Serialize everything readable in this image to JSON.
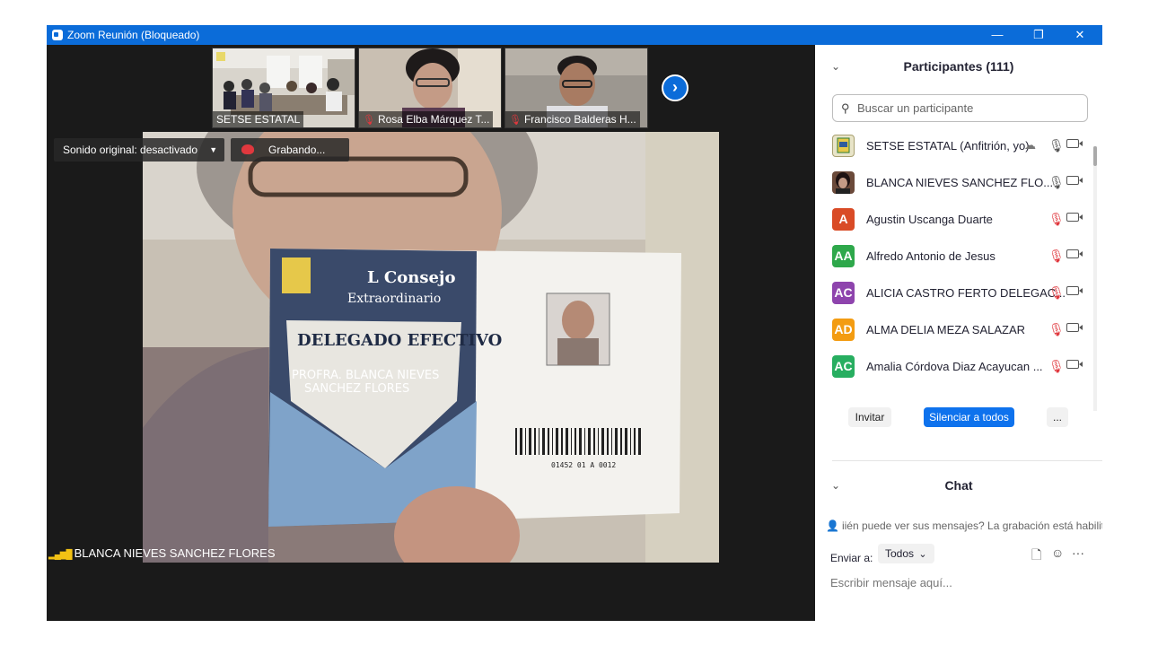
{
  "window": {
    "title": "Zoom Reunión (Bloqueado)",
    "minimize": "—",
    "restore": "❐",
    "close": "✕"
  },
  "strip": {
    "thumbnails": [
      {
        "name": "SETSE ESTATAL",
        "muted": false
      },
      {
        "name": "Rosa Elba Márquez T...",
        "muted": true
      },
      {
        "name": "Francisco Balderas H...",
        "muted": true
      }
    ],
    "next": "›"
  },
  "main_video": {
    "sound_label": "Sonido original: desactivado",
    "sound_arrow": "▼",
    "recording_label": "Grabando...",
    "speaker_name": "BLANCA NIEVES  SANCHEZ FLORES",
    "signal_icon": "signal-bars-icon",
    "card_text": {
      "line1": "L Consejo",
      "line2": "Extraordinario",
      "line3": "DELEGADO EFECTIVO",
      "line4": "PROFRA. BLANCA NIEVES",
      "line5": "SANCHEZ FLORES",
      "code": "01452 01 A 0012"
    }
  },
  "participants": {
    "header": "Participantes (111)",
    "chevron": "⌄",
    "search_placeholder": "Buscar un participante",
    "search_icon": "🔍",
    "list": [
      {
        "initials": "",
        "name": "SETSE ESTATAL (Anfitrión, yo)",
        "avatar_color": "#e8e4c8",
        "muted": false,
        "cloud": true
      },
      {
        "initials": "",
        "name": "BLANCA NIEVES  SANCHEZ FLO...",
        "avatar_color": "#6b4a3a",
        "muted": false,
        "cloud": false
      },
      {
        "initials": "A",
        "name": "Agustin Uscanga Duarte",
        "avatar_color": "#d94b26",
        "muted": true,
        "cloud": false
      },
      {
        "initials": "AA",
        "name": "Alfredo Antonio de Jesus",
        "avatar_color": "#2ea84b",
        "muted": true,
        "cloud": false
      },
      {
        "initials": "AC",
        "name": "ALICIA CASTRO FERTO DELEGAC...",
        "avatar_color": "#8e44ad",
        "muted": true,
        "cloud": false
      },
      {
        "initials": "AD",
        "name": "ALMA DELIA MEZA SALAZAR",
        "avatar_color": "#f39c12",
        "muted": true,
        "cloud": false
      },
      {
        "initials": "AC",
        "name": "Amalia Córdova Diaz Acayucan ...",
        "avatar_color": "#27ae60",
        "muted": true,
        "cloud": false
      }
    ],
    "mic_on": "🎙",
    "mic_off": "🎙",
    "buttons": {
      "invite": "Invitar",
      "mute_all": "Silenciar a todos",
      "more": "..."
    }
  },
  "chat": {
    "header": "Chat",
    "notice": "iién puede ver sus mensajes? La grabación está habilit",
    "send_to_label": "Enviar a:",
    "recipient": "Todos",
    "recipient_arrow": "⌄",
    "input_placeholder": "Escribir mensaje aquí...",
    "file_icon": "🗋",
    "emoji_icon": "☺",
    "more_icon": "···"
  }
}
